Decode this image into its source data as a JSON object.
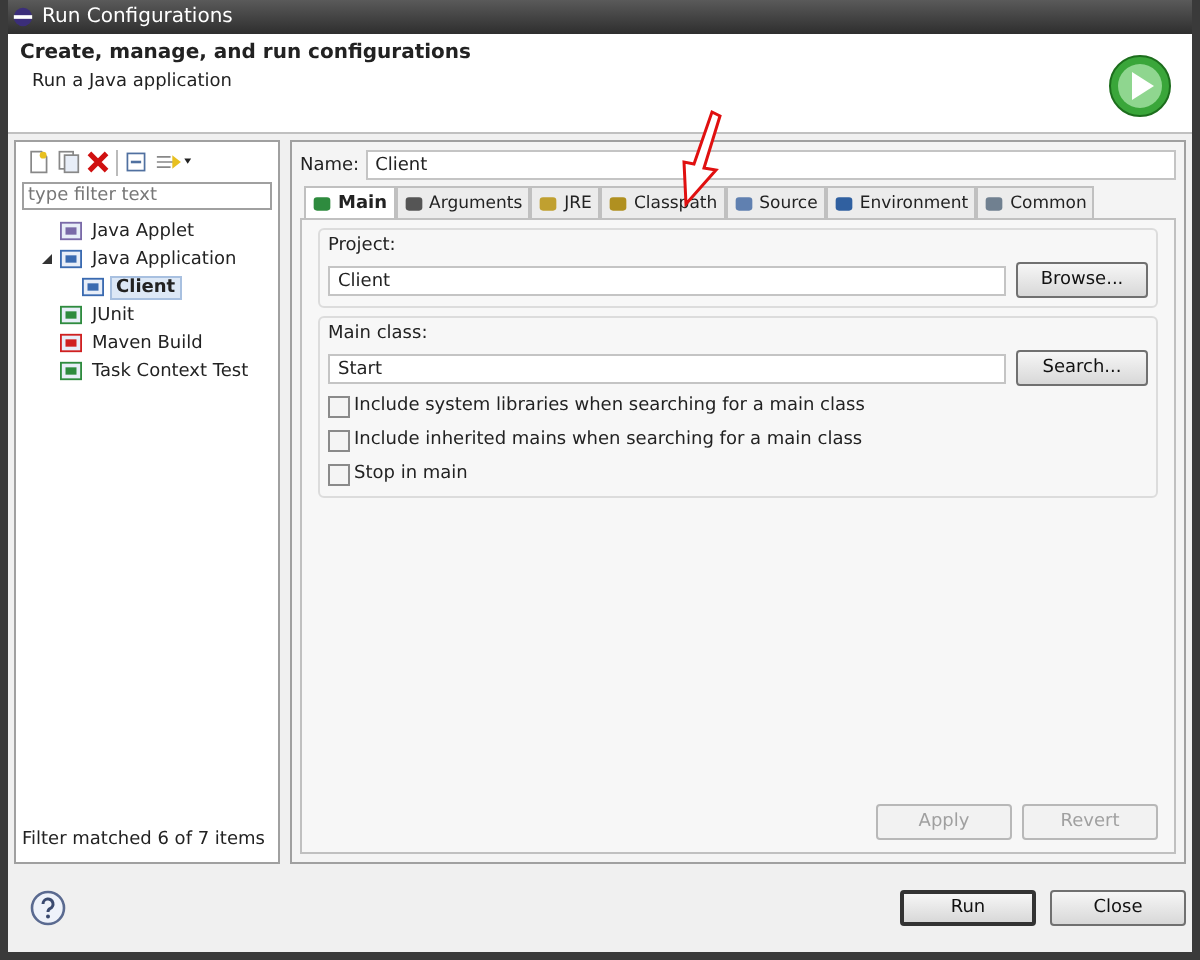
{
  "window": {
    "title": "Run Configurations"
  },
  "header": {
    "title": "Create, manage, and run configurations",
    "subtitle": "Run a Java application"
  },
  "sidebar": {
    "filter": {
      "placeholder": "type filter text"
    },
    "tree": [
      {
        "label": "Java Applet",
        "selected": false
      },
      {
        "label": "Java Application",
        "selected": false,
        "expanded": true,
        "children": [
          {
            "label": "Client",
            "selected": true
          }
        ]
      },
      {
        "label": "JUnit",
        "selected": false
      },
      {
        "label": "Maven Build",
        "selected": false
      },
      {
        "label": "Task Context Test",
        "selected": false
      }
    ],
    "status": "Filter matched 6 of 7 items"
  },
  "name": {
    "label": "Name:",
    "value": "Client"
  },
  "tabs": [
    {
      "label": "Main",
      "selected": true
    },
    {
      "label": "Arguments",
      "selected": false
    },
    {
      "label": "JRE",
      "selected": false
    },
    {
      "label": "Classpath",
      "selected": false
    },
    {
      "label": "Source",
      "selected": false
    },
    {
      "label": "Environment",
      "selected": false
    },
    {
      "label": "Common",
      "selected": false
    }
  ],
  "project": {
    "label": "Project:",
    "value": "Client",
    "button": "Browse..."
  },
  "main_class": {
    "label": "Main class:",
    "value": "Start",
    "button": "Search..."
  },
  "options": [
    {
      "label": "Include system libraries when searching for a main class",
      "checked": false
    },
    {
      "label": "Include inherited mains when searching for a main class",
      "checked": false
    },
    {
      "label": "Stop in main",
      "checked": false
    }
  ],
  "panel_buttons": [
    {
      "label": "Apply",
      "disabled": true
    },
    {
      "label": "Revert",
      "disabled": true
    }
  ],
  "dialog_buttons": [
    {
      "label": "Run",
      "default": true
    },
    {
      "label": "Close",
      "default": false
    }
  ]
}
